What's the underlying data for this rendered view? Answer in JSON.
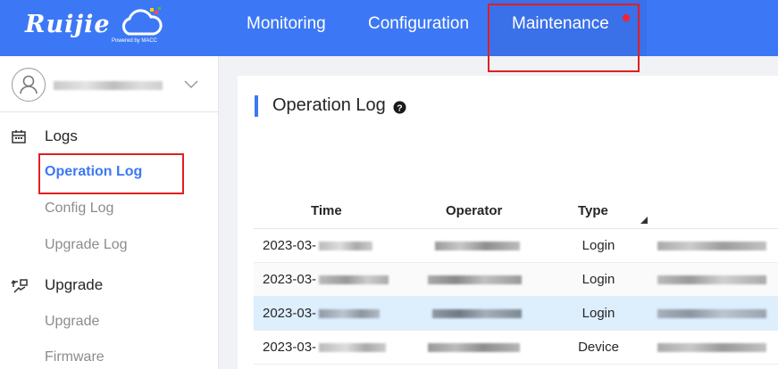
{
  "brand": {
    "name": "Ruijie",
    "tagline": "Powered by MACC"
  },
  "nav": {
    "items": [
      {
        "label": "Monitoring"
      },
      {
        "label": "Configuration"
      },
      {
        "label": "Maintenance"
      }
    ],
    "active": "Maintenance"
  },
  "sidebar": {
    "groups": [
      {
        "label": "Logs",
        "icon": "calendar-icon",
        "items": [
          {
            "label": "Operation Log",
            "active": true
          },
          {
            "label": "Config Log"
          },
          {
            "label": "Upgrade Log"
          }
        ]
      },
      {
        "label": "Upgrade",
        "icon": "upgrade-icon",
        "items": [
          {
            "label": "Upgrade"
          },
          {
            "label": "Firmware"
          }
        ]
      }
    ]
  },
  "main": {
    "title": "Operation Log",
    "table": {
      "headers": [
        "Time",
        "Operator",
        "Type"
      ],
      "rows": [
        {
          "time": "2023-03-",
          "type": "Login"
        },
        {
          "time": "2023-03-",
          "type": "Login"
        },
        {
          "time": "2023-03-",
          "type": "Login"
        },
        {
          "time": "2023-03-",
          "type": "Device"
        }
      ]
    }
  },
  "colors": {
    "accent": "#3c78f5",
    "highlight": "#e02020",
    "selected_row": "#ddeefd"
  }
}
